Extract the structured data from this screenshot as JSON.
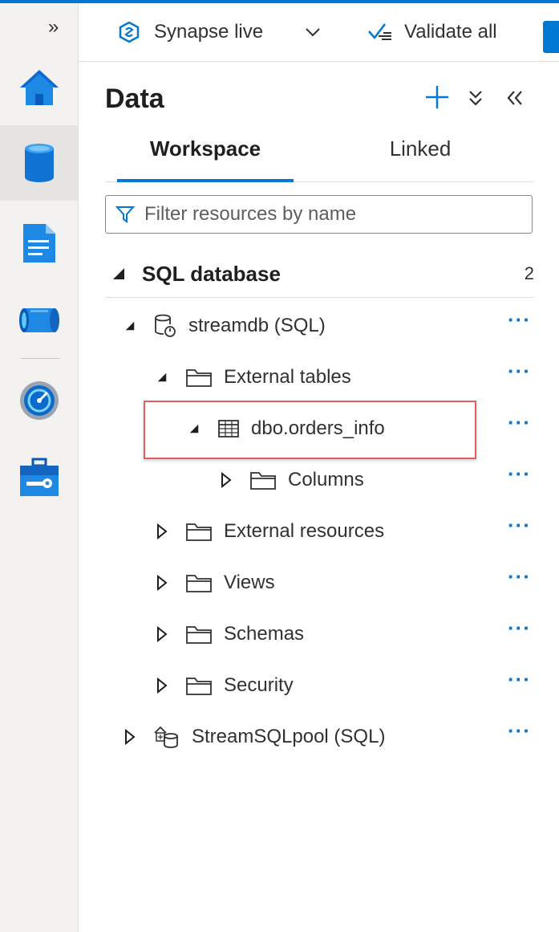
{
  "topbar": {
    "workspace_label": "Synapse live",
    "validate_label": "Validate all"
  },
  "rail": {
    "items": [
      {
        "icon": "home-icon"
      },
      {
        "icon": "data-icon"
      },
      {
        "icon": "develop-icon"
      },
      {
        "icon": "integrate-icon"
      },
      {
        "icon": "monitor-icon"
      },
      {
        "icon": "manage-icon"
      }
    ],
    "active_index": 1
  },
  "panel": {
    "title": "Data",
    "tabs": [
      {
        "label": "Workspace",
        "selected": true
      },
      {
        "label": "Linked",
        "selected": false
      }
    ],
    "filter_placeholder": "Filter resources by name"
  },
  "section": {
    "title": "SQL database",
    "count": "2"
  },
  "tree": [
    {
      "label": "streamdb (SQL)",
      "icon": "sql-database-icon",
      "expanded": true,
      "more": "···"
    },
    {
      "label": "External tables",
      "icon": "folder-icon",
      "expanded": true,
      "more": "···"
    },
    {
      "label": "dbo.orders_info",
      "icon": "table-icon",
      "expanded": true,
      "highlighted": true,
      "more": "···"
    },
    {
      "label": "Columns",
      "icon": "folder-icon",
      "expanded": false,
      "more": "···"
    },
    {
      "label": "External resources",
      "icon": "folder-icon",
      "expanded": false,
      "more": "···"
    },
    {
      "label": "Views",
      "icon": "folder-icon",
      "expanded": false,
      "more": "···"
    },
    {
      "label": "Schemas",
      "icon": "folder-icon",
      "expanded": false,
      "more": "···"
    },
    {
      "label": "Security",
      "icon": "folder-icon",
      "expanded": false,
      "more": "···"
    },
    {
      "label": "StreamSQLpool (SQL)",
      "icon": "sql-pool-icon",
      "expanded": false,
      "more": "···"
    }
  ],
  "colors": {
    "accent": "#0078d4",
    "highlight_border": "#e05d62"
  }
}
